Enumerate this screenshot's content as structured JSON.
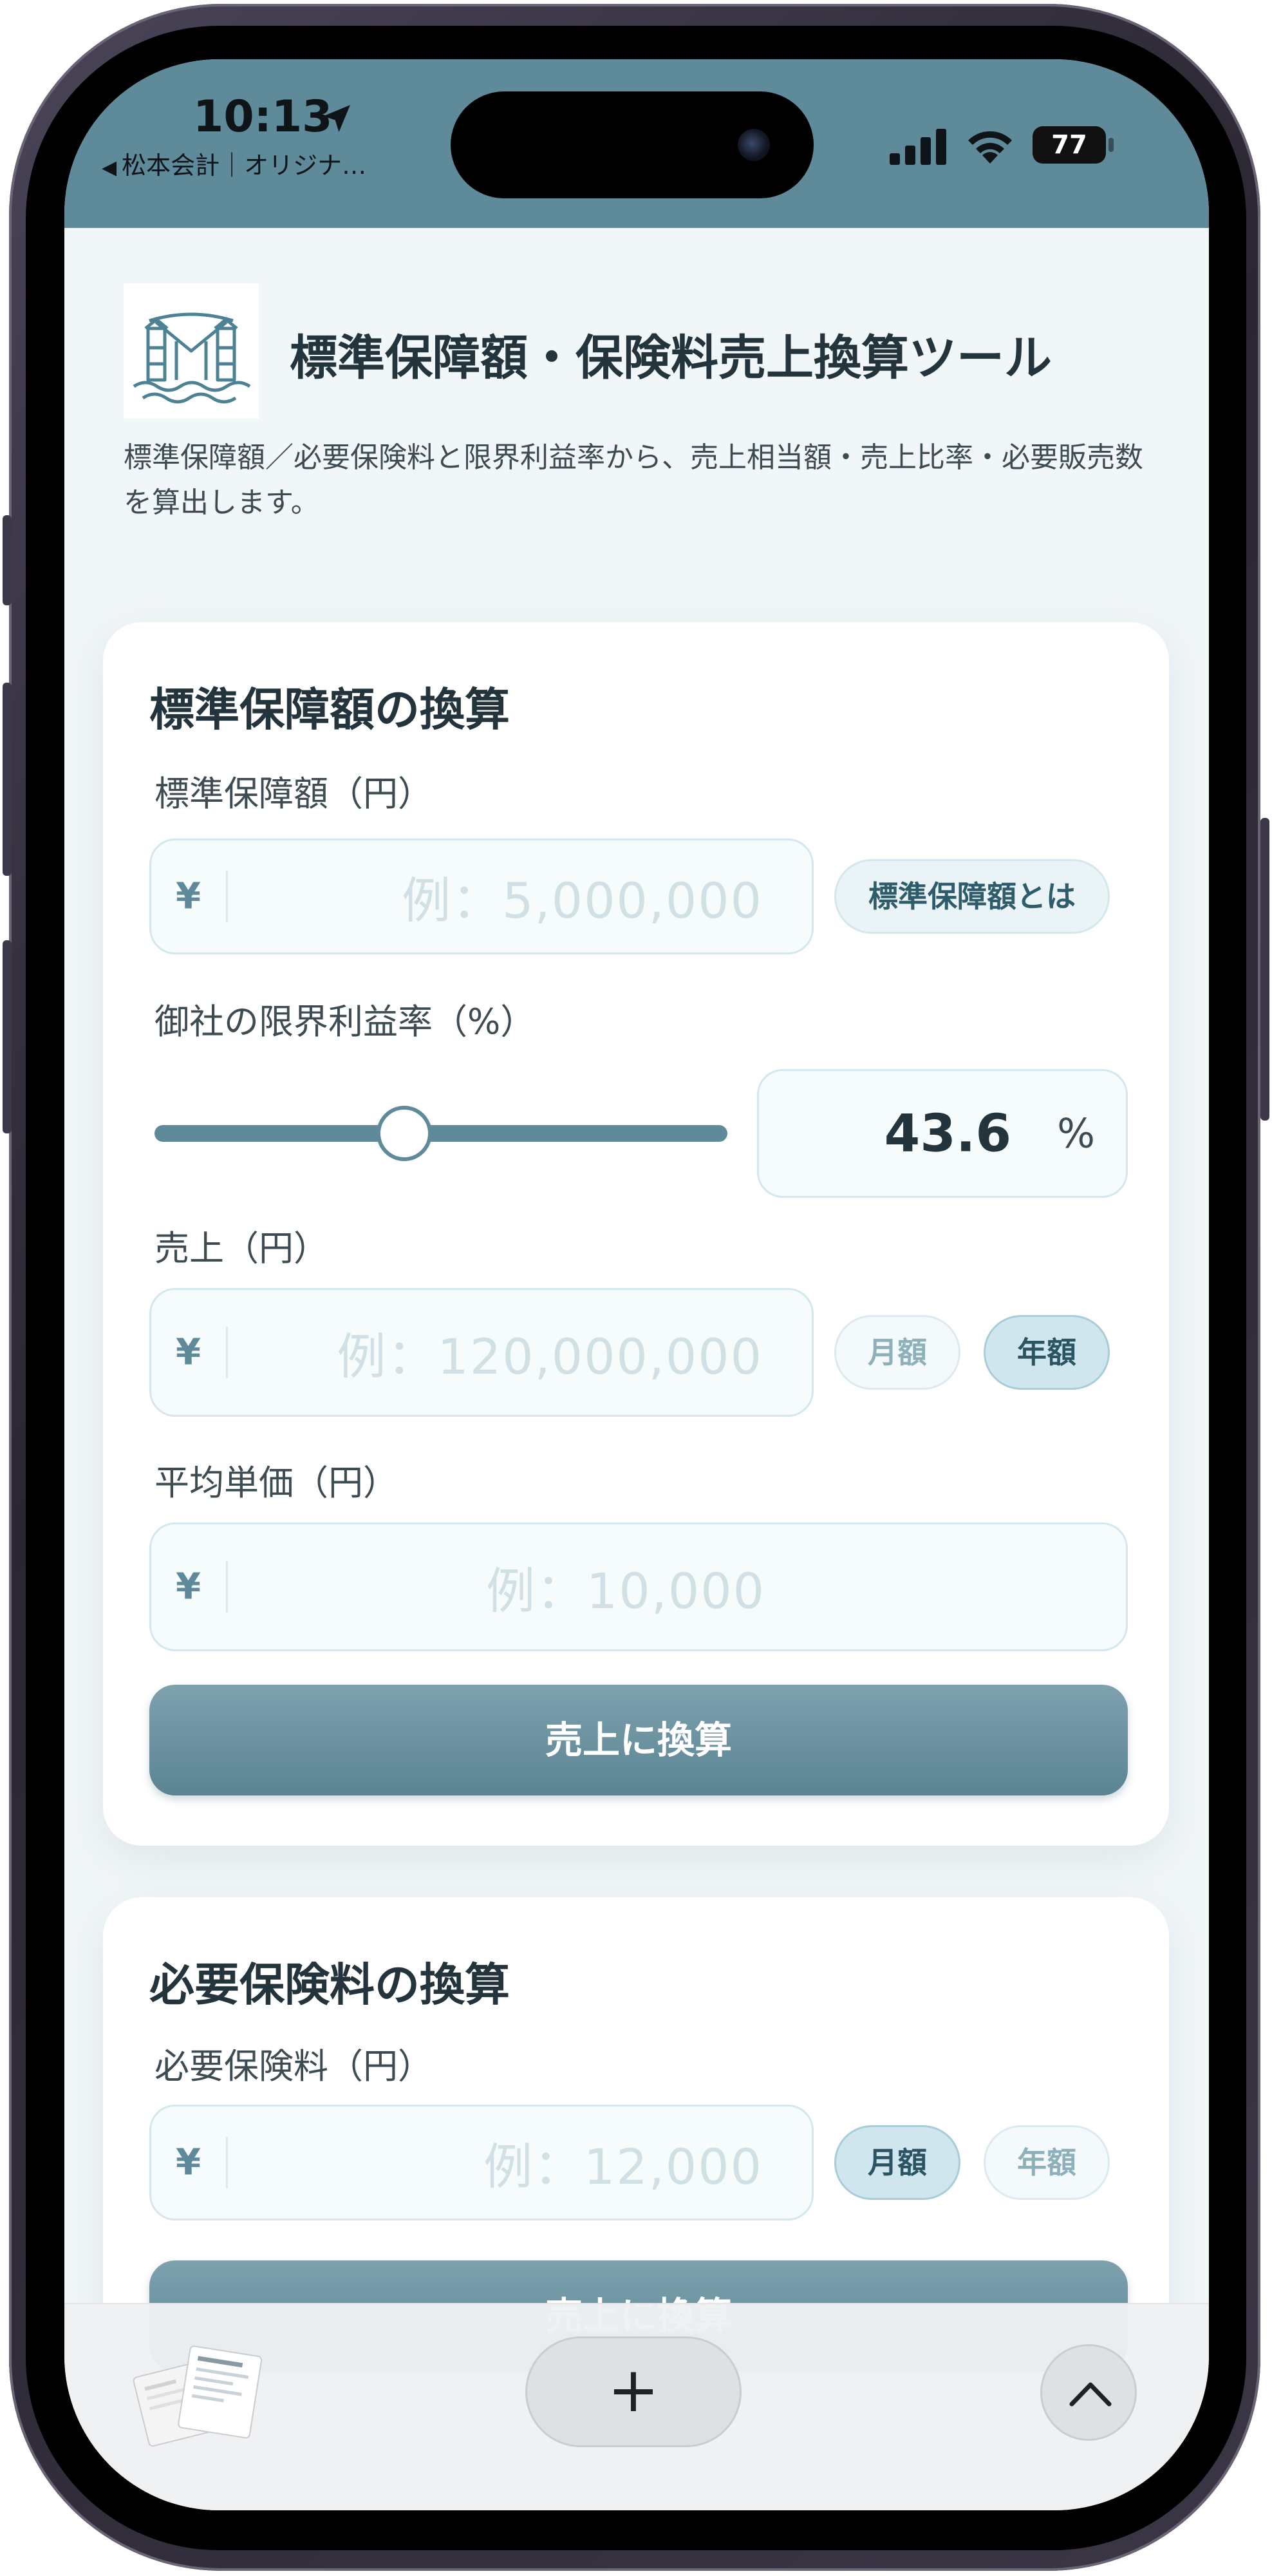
{
  "status_bar": {
    "time": "10:13",
    "back_app": "松本会計｜オリジナ…",
    "battery": "77"
  },
  "header": {
    "title": "標準保障額・保険料売上換算ツール",
    "description": "標準保障額／必要保険料と限界利益率から、売上相当額・売上比率・必要販売数を算出します。"
  },
  "card1": {
    "title": "標準保障額の換算",
    "coverage_label": "標準保障額（円）",
    "coverage_placeholder": "例：5,000,000",
    "coverage_info_button": "標準保障額とは",
    "margin_label": "御社の限界利益率（%）",
    "margin_value": "43.6",
    "margin_unit": "%",
    "margin_slider_fraction": 0.436,
    "sales_label": "売上（円）",
    "sales_placeholder": "例：120,000,000",
    "toggle_monthly": "月額",
    "toggle_yearly": "年額",
    "toggle_selected": "年額",
    "price_label": "平均単価（円）",
    "price_placeholder": "例：10,000",
    "submit": "売上に換算"
  },
  "card2": {
    "title": "必要保険料の換算",
    "premium_label": "必要保険料（円）",
    "premium_placeholder": "例：12,000",
    "toggle_monthly": "月額",
    "toggle_yearly": "年額",
    "toggle_selected": "月額",
    "submit": "売上に換算"
  },
  "currency_symbol": "¥",
  "toolbar": {
    "new_tab": "+"
  },
  "colors": {
    "accent": "#5e8a9a",
    "title_text": "#24343c",
    "page_bg": "#f1f6f8"
  }
}
